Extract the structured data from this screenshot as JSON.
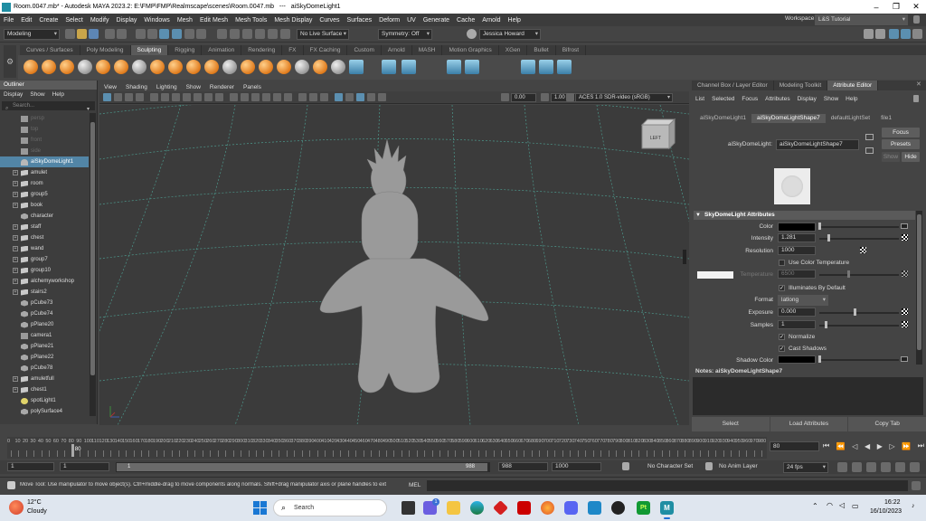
{
  "window": {
    "title": "Room.0047.mb* - Autodesk MAYA 2023.2: E:\\FMP\\FMP\\Realmscape\\scenes\\Room.0047.mb   ---   aiSkyDomeLight1",
    "controls": [
      "–",
      "❐",
      "✕"
    ]
  },
  "menubar": [
    "File",
    "Edit",
    "Create",
    "Select",
    "Modify",
    "Display",
    "Windows",
    "Mesh",
    "Edit Mesh",
    "Mesh Tools",
    "Mesh Display",
    "Curves",
    "Surfaces",
    "Deform",
    "UV",
    "Generate",
    "Cache",
    "Arnold",
    "Help"
  ],
  "workspace": {
    "label": "Workspace:",
    "value": "L&S Tutorial"
  },
  "status_line": {
    "mode": "Modeling",
    "live_surface": "No Live Surface",
    "symmetry": "Symmetry: Off",
    "user": "Jessica Howard"
  },
  "shelf_tabs": [
    "Curves / Surfaces",
    "Poly Modeling",
    "Sculpting",
    "Rigging",
    "Animation",
    "Rendering",
    "FX",
    "FX Caching",
    "Custom",
    "Arnold",
    "MASH",
    "Motion Graphics",
    "XGen",
    "Bullet",
    "Bifrost"
  ],
  "shelf_active_tab": "Sculpting",
  "outliner": {
    "title": "Outliner",
    "menu": [
      "Display",
      "Show",
      "Help"
    ],
    "search_placeholder": "Search...",
    "items": [
      {
        "label": "persp",
        "icon": "camera-icon",
        "dim": true,
        "expand": false
      },
      {
        "label": "top",
        "icon": "camera-icon",
        "dim": true,
        "expand": false
      },
      {
        "label": "front",
        "icon": "camera-icon",
        "dim": true,
        "expand": false
      },
      {
        "label": "side",
        "icon": "camera-icon",
        "dim": true,
        "expand": false
      },
      {
        "label": "aiSkyDomeLight1",
        "icon": "dome-light-icon",
        "selected": true,
        "expand": false
      },
      {
        "label": "amulet",
        "icon": "group-icon",
        "expand": true
      },
      {
        "label": "room",
        "icon": "group-icon",
        "expand": true
      },
      {
        "label": "group5",
        "icon": "group-icon",
        "expand": true
      },
      {
        "label": "book",
        "icon": "group-icon",
        "expand": true
      },
      {
        "label": "character",
        "icon": "mesh-icon",
        "expand": false
      },
      {
        "label": "staff",
        "icon": "group-icon",
        "expand": true
      },
      {
        "label": "chest",
        "icon": "group-icon",
        "expand": true
      },
      {
        "label": "wand",
        "icon": "group-icon",
        "expand": true
      },
      {
        "label": "group7",
        "icon": "group-icon",
        "expand": true
      },
      {
        "label": "group10",
        "icon": "group-icon",
        "expand": true
      },
      {
        "label": "alchemyworkshop",
        "icon": "group-icon",
        "expand": true
      },
      {
        "label": "stairs2",
        "icon": "group-icon",
        "expand": true
      },
      {
        "label": "pCube73",
        "icon": "mesh-icon",
        "expand": false
      },
      {
        "label": "pCube74",
        "icon": "mesh-icon",
        "expand": false
      },
      {
        "label": "pPlane20",
        "icon": "mesh-icon",
        "expand": false
      },
      {
        "label": "camera1",
        "icon": "camera-icon",
        "expand": false
      },
      {
        "label": "pPlane21",
        "icon": "mesh-icon",
        "expand": false
      },
      {
        "label": "pPlane22",
        "icon": "mesh-icon",
        "expand": false
      },
      {
        "label": "pCube78",
        "icon": "mesh-icon",
        "expand": false
      },
      {
        "label": "amuletfull",
        "icon": "group-icon",
        "expand": true
      },
      {
        "label": "chest1",
        "icon": "group-icon",
        "expand": true
      },
      {
        "label": "spotLight1",
        "icon": "light-icon",
        "expand": false
      },
      {
        "label": "polySurface4",
        "icon": "mesh-icon",
        "expand": false
      }
    ]
  },
  "viewport": {
    "menu": [
      "View",
      "Shading",
      "Lighting",
      "Show",
      "Renderer",
      "Panels"
    ],
    "field_a": "0.00",
    "field_b": "1.00",
    "color_space": "ACES 1.0 SDR-video (sRGB)",
    "view_cube_label": "LEFT"
  },
  "right_panel": {
    "tabs": [
      "Channel Box / Layer Editor",
      "Modeling Toolkit",
      "Attribute Editor"
    ],
    "active_tab": "Attribute Editor",
    "menu": [
      "List",
      "Selected",
      "Focus",
      "Attributes",
      "Display",
      "Show",
      "Help"
    ],
    "node_tabs": [
      "aiSkyDomeLight1",
      "aiSkyDomeLightShape7",
      "defaultLightSet",
      "file1"
    ],
    "active_node_tab": "aiSkyDomeLightShape7",
    "node_label": "aiSkyDomeLight:",
    "node_value": "aiSkyDomeLightShape7",
    "buttons": {
      "focus": "Focus",
      "presets": "Presets",
      "show": "Show",
      "hide": "Hide"
    },
    "section_title": "SkyDomeLight Attributes",
    "attributes": {
      "color_label": "Color",
      "intensity_label": "Intensity",
      "intensity_value": "1.281",
      "resolution_label": "Resolution",
      "resolution_value": "1000",
      "use_color_temp_label": "Use Color Temperature",
      "temperature_label": "Temperature",
      "temperature_value": "6500",
      "illuminates_label": "Illuminates By Default",
      "format_label": "Format",
      "format_value": "latlong",
      "exposure_label": "Exposure",
      "exposure_value": "0.000",
      "samples_label": "Samples",
      "samples_value": "1",
      "normalize_label": "Normalize",
      "cast_shadows_label": "Cast Shadows",
      "shadow_color_label": "Shadow Color"
    },
    "notes_label": "Notes:  aiSkyDomeLightShape7",
    "bottom_buttons": [
      "Select",
      "Load Attributes",
      "Copy Tab"
    ]
  },
  "timeline": {
    "ticks": [
      "0",
      "10",
      "20",
      "30",
      "40",
      "50",
      "60",
      "70",
      "80",
      "90",
      "100",
      "110",
      "120",
      "130",
      "140",
      "150",
      "160",
      "170",
      "180",
      "190",
      "200",
      "210",
      "220",
      "230",
      "240",
      "250",
      "260",
      "270",
      "280",
      "290",
      "300",
      "310",
      "320",
      "330",
      "340",
      "350",
      "360",
      "370",
      "380",
      "390",
      "400",
      "410",
      "420",
      "430",
      "440",
      "450",
      "460",
      "470",
      "480",
      "490",
      "500",
      "510",
      "520",
      "530",
      "540",
      "550",
      "560",
      "570",
      "580",
      "590",
      "600",
      "610",
      "620",
      "630",
      "640",
      "650",
      "660",
      "670",
      "680",
      "690",
      "700",
      "710",
      "720",
      "730",
      "740",
      "750",
      "760",
      "770",
      "780",
      "790",
      "800",
      "810",
      "820",
      "830",
      "840",
      "850",
      "860",
      "870",
      "880",
      "890",
      "900",
      "910",
      "920",
      "930",
      "940",
      "950",
      "960",
      "970",
      "980"
    ],
    "current_frame_marker": "80",
    "current_frame": "80"
  },
  "range": {
    "start": "1",
    "start_inner": "1",
    "range_start_label": "1",
    "range_end_label": "988",
    "end_inner": "988",
    "end": "1000",
    "character_set": "No Character Set",
    "anim_layer": "No Anim Layer",
    "fps": "24 fps"
  },
  "command_line": {
    "help_text": "Move Tool: Use manipulator to move object(s). Ctrl+middle-drag to move components along normals. Shift+drag manipulator axis or plane handles to ext",
    "language": "MEL"
  },
  "taskbar": {
    "weather_temp": "12°C",
    "weather_desc": "Cloudy",
    "search_placeholder": "Search",
    "time": "16:22",
    "date": "16/10/2023",
    "chat_badge": "1"
  }
}
